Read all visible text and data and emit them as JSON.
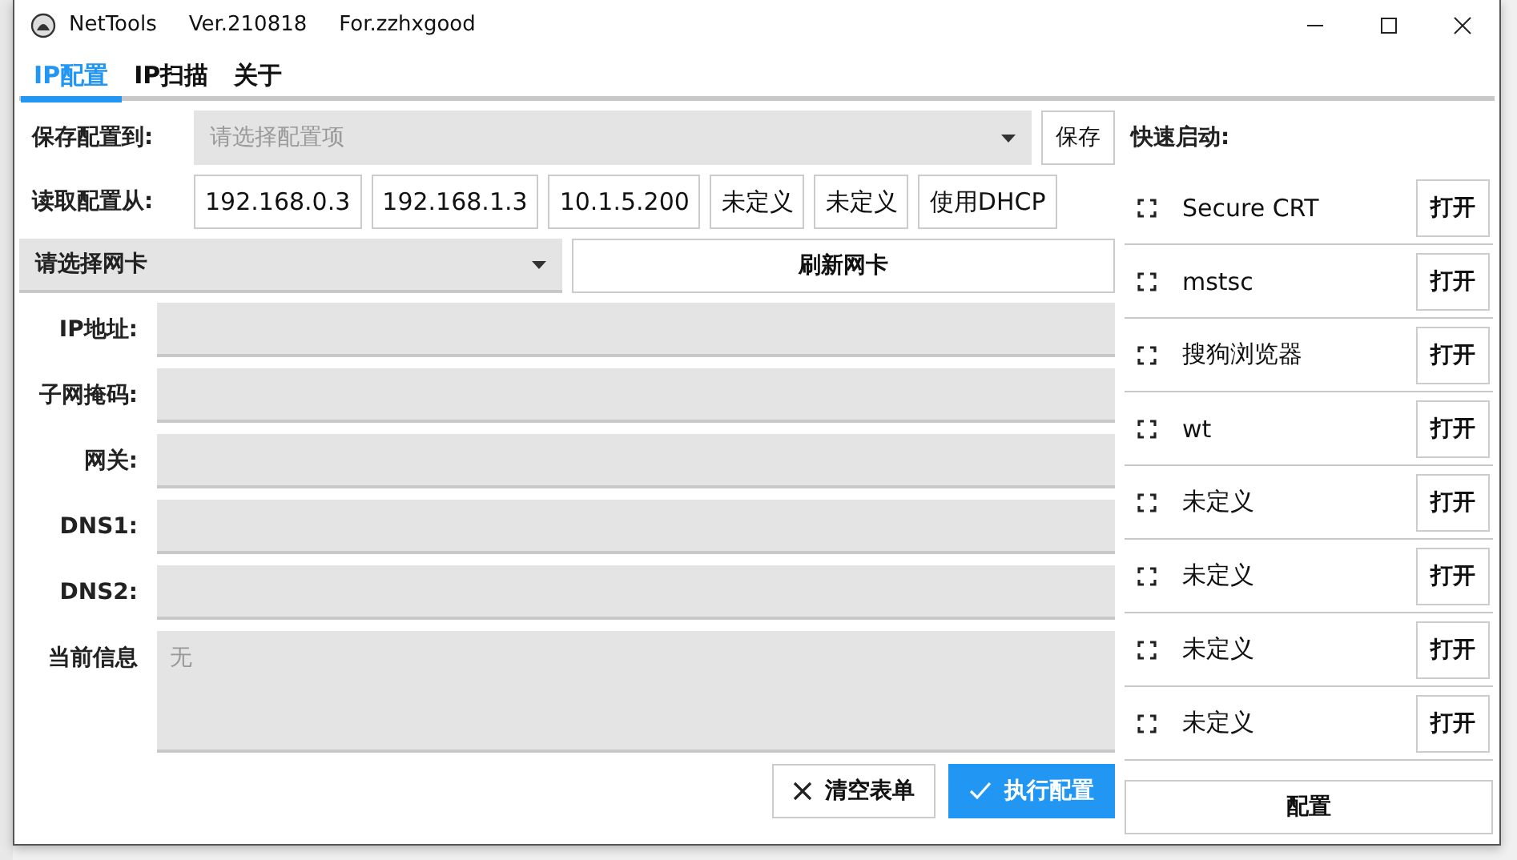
{
  "window": {
    "title": "NetTools",
    "version": "Ver.210818",
    "author": "For.zzhxgood"
  },
  "tabs": [
    {
      "label": "IP配置",
      "selected": true
    },
    {
      "label": "IP扫描",
      "selected": false
    },
    {
      "label": "关于",
      "selected": false
    }
  ],
  "save_row": {
    "label": "保存配置到:",
    "placeholder": "请选择配置项",
    "button": "保存"
  },
  "read_row": {
    "label": "读取配置从:",
    "buttons": [
      "192.168.0.3",
      "192.168.1.3",
      "10.1.5.200",
      "未定义",
      "未定义",
      "使用DHCP"
    ]
  },
  "nic_row": {
    "placeholder": "请选择网卡",
    "button": "刷新网卡"
  },
  "fields": [
    {
      "label": "IP地址:"
    },
    {
      "label": "子网掩码:"
    },
    {
      "label": "网关:"
    },
    {
      "label": "DNS1:"
    },
    {
      "label": "DNS2:"
    }
  ],
  "info": {
    "label": "当前信息",
    "placeholder": "无"
  },
  "actions": [
    {
      "label": "清空表单",
      "kind": "clear"
    },
    {
      "label": "执行配置",
      "kind": "run"
    }
  ],
  "quick_launch": {
    "title": "快速启动:",
    "items": [
      {
        "name": "Secure CRT",
        "button": "打开"
      },
      {
        "name": "mstsc",
        "button": "打开"
      },
      {
        "name": "搜狗浏览器",
        "button": "打开"
      },
      {
        "name": "wt",
        "button": "打开"
      },
      {
        "name": "未定义",
        "button": "打开"
      },
      {
        "name": "未定义",
        "button": "打开"
      },
      {
        "name": "未定义",
        "button": "打开"
      },
      {
        "name": "未定义",
        "button": "打开"
      }
    ],
    "config_button": "配置"
  }
}
